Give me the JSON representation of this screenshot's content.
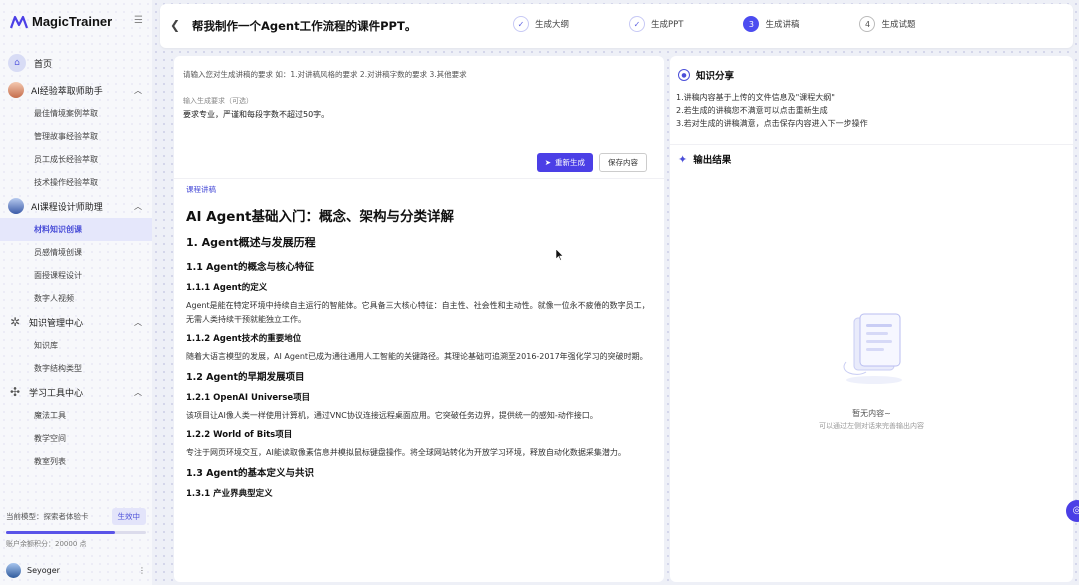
{
  "app": {
    "name": "MagicTrainer"
  },
  "sidebar": {
    "home_label": "首页",
    "groups": [
      {
        "label": "AI经验萃取师助手",
        "items": [
          "最佳情境案例萃取",
          "管理故事经验萃取",
          "员工成长经验萃取",
          "技术操作经验萃取"
        ]
      },
      {
        "label": "AI课程设计师助理",
        "items": [
          "材料知识创课",
          "员感情境创课",
          "面授课程设计",
          "数字人视频"
        ]
      },
      {
        "label": "知识管理中心",
        "items": [
          "知识库",
          "数字结构类型"
        ]
      },
      {
        "label": "学习工具中心",
        "items": [
          "魔法工具",
          "教学空间",
          "教室列表"
        ]
      }
    ],
    "active_item": "材料知识创课",
    "footer": {
      "mode_text": "当前模型：探索者体验卡",
      "mode_button": "生效中",
      "progress": 0.78,
      "points_text": "账户余额积分：20000 点"
    },
    "user": {
      "name": "Seyoger"
    }
  },
  "header": {
    "title": "帮我制作一个Agent工作流程的课件PPT。",
    "steps": [
      {
        "index": "1",
        "label": "生成大纲",
        "state": "done"
      },
      {
        "index": "2",
        "label": "生成PPT",
        "state": "done"
      },
      {
        "index": "3",
        "label": "生成讲稿",
        "state": "current"
      },
      {
        "index": "4",
        "label": "生成试题",
        "state": "pending"
      }
    ]
  },
  "editor": {
    "hint": "请输入您对生成讲稿的要求 如：1.对讲稿风格的要求 2.对讲稿字数的要求 3.其他要求",
    "input_label": "输入生成要求（可选）",
    "input_value": "要求专业，严谨和每段字数不超过50字。",
    "regenerate_button": "重新生成",
    "save_button": "保存内容"
  },
  "doc": {
    "tag": "课程讲稿",
    "title": "AI Agent基础入门：概念、架构与分类详解",
    "sections": [
      {
        "level": "h2",
        "text": "1. Agent概述与发展历程"
      },
      {
        "level": "h3",
        "text": "1.1 Agent的概念与核心特征"
      },
      {
        "level": "h4",
        "text": "1.1.1 Agent的定义"
      },
      {
        "level": "p",
        "text": "Agent是能在特定环境中持续自主运行的智能体。它具备三大核心特征：自主性、社会性和主动性。就像一位永不疲倦的数字员工，无需人类持续干预就能独立工作。"
      },
      {
        "level": "h4",
        "text": "1.1.2 Agent技术的重要地位"
      },
      {
        "level": "p",
        "text": "随着大语言模型的发展，AI Agent已成为通往通用人工智能的关键路径。其理论基础可追溯至2016-2017年强化学习的突破时期。"
      },
      {
        "level": "h3",
        "text": "1.2 Agent的早期发展项目"
      },
      {
        "level": "h4",
        "text": "1.2.1 OpenAI Universe项目"
      },
      {
        "level": "p",
        "text": "该项目让AI像人类一样使用计算机，通过VNC协议连接远程桌面应用。它突破任务边界，提供统一的感知-动作接口。"
      },
      {
        "level": "h4",
        "text": "1.2.2 World of Bits项目"
      },
      {
        "level": "p",
        "text": "专注于网页环境交互，AI能读取像素信息并模拟鼠标键盘操作。将全球网站转化为开放学习环境，释放自动化数据采集潜力。"
      },
      {
        "level": "h3",
        "text": "1.3 Agent的基本定义与共识"
      },
      {
        "level": "h4",
        "text": "1.3.1 产业界典型定义"
      }
    ]
  },
  "knowledge": {
    "title": "知识分享",
    "tips": [
      "1.讲稿内容基于上传的文件信息及\"课程大纲\"",
      "2.若生成的讲稿您不满意可以点击重新生成",
      "3.若对生成的讲稿满意，点击保存内容进入下一步操作"
    ]
  },
  "output": {
    "title": "输出结果",
    "empty_title": "暂无内容~",
    "empty_sub": "可以通过左侧对话来完善输出内容"
  },
  "colors": {
    "accent": "#4b3fe6",
    "active_bg": "#e5e7fb"
  }
}
